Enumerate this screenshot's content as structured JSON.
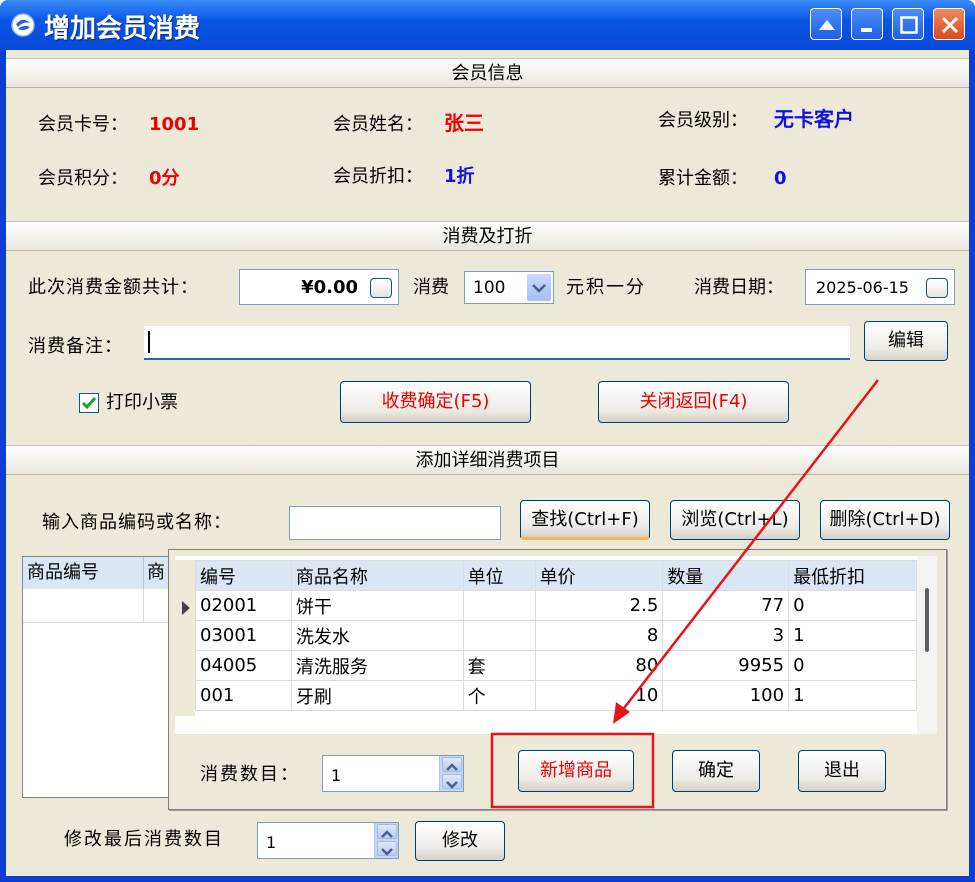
{
  "window": {
    "title": "增加会员消费"
  },
  "member_info": {
    "section_title": "会员信息",
    "card_no_label": "会员卡号：",
    "card_no": "1001",
    "name_label": "会员姓名：",
    "name": "张三",
    "level_label": "会员级别：",
    "level": "无卡客户",
    "points_label": "会员积分：",
    "points": "0分",
    "discount_label": "会员折扣：",
    "discount": "1折",
    "total_label": "累计金额：",
    "total": "0"
  },
  "consumption": {
    "section_title": "消费及打折",
    "amount_label": "此次消费金额共计：",
    "amount": "¥0.00",
    "spend_label": "消费",
    "rate": "100",
    "rate_unit": "元积一分",
    "date_label": "消费日期：",
    "date": "2025-06-15",
    "note_label": "消费备注：",
    "note": "",
    "edit_button": "编辑",
    "print_receipt": "打印小票",
    "print_checked": true,
    "confirm_button": "收费确定(F5)",
    "close_button": "关闭返回(F4)"
  },
  "detail": {
    "section_title": "添加详细消费项目",
    "search_label": "输入商品编码或名称：",
    "search_value": "",
    "find_button": "查找(Ctrl+F)",
    "browse_button": "浏览(Ctrl+L)",
    "delete_button": "删除(Ctrl+D)",
    "grid_headers": [
      "商品编号",
      "商"
    ],
    "modify_label": "修改最后消费数目",
    "modify_value": "1",
    "modify_button": "修改"
  },
  "popup": {
    "headers": [
      "编号",
      "商品名称",
      "单位",
      "单价",
      "数量",
      "最低折扣"
    ],
    "rows": [
      [
        "02001",
        "饼干",
        "",
        "2.5",
        "77",
        "0"
      ],
      [
        "03001",
        "洗发水",
        "",
        "8",
        "3",
        "1"
      ],
      [
        "04005",
        "清洗服务",
        "套",
        "80",
        "9955",
        "0"
      ],
      [
        "001",
        "牙刷",
        "个",
        "10",
        "100",
        "1"
      ]
    ],
    "qty_label": "消费数目：",
    "qty_value": "1",
    "new_button": "新增商品",
    "ok_button": "确定",
    "exit_button": "退出"
  },
  "colors": {
    "annotation": "#e8141c",
    "title_bar": "#0b56e6"
  }
}
